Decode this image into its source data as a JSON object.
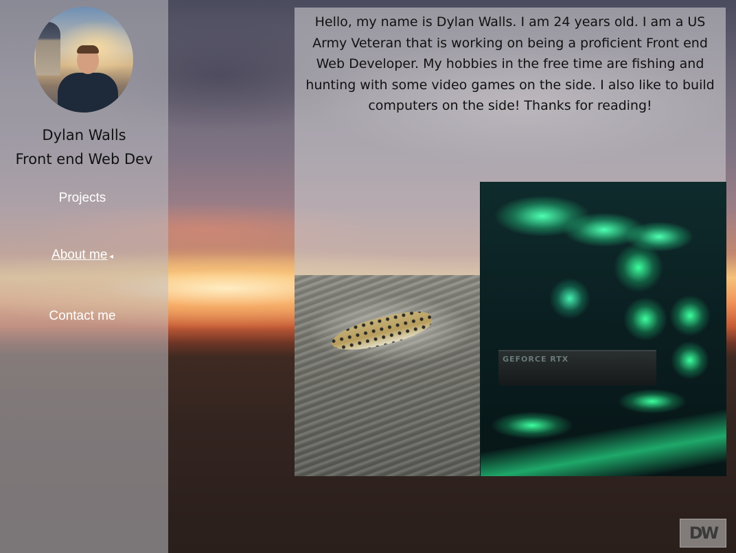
{
  "profile": {
    "name": "Dylan Walls",
    "role": "Front end Web Dev"
  },
  "nav": {
    "items": [
      {
        "label": "Projects",
        "active": false
      },
      {
        "label": "About me",
        "active": true
      },
      {
        "label": "Contact me",
        "active": false
      }
    ],
    "active_indicator": "◂"
  },
  "about": {
    "bio": "Hello, my name is Dylan Walls. I am 24 years old. I am a US Army Veteran that is working on being  a proficient Front end Web Developer. My hobbies in the free time are fishing and hunting with some video games on the side. I also like to build computers on the side! Thanks for reading!"
  },
  "photos": {
    "pc_label": "GEFORCE RTX"
  },
  "logo": {
    "text": "DW"
  }
}
